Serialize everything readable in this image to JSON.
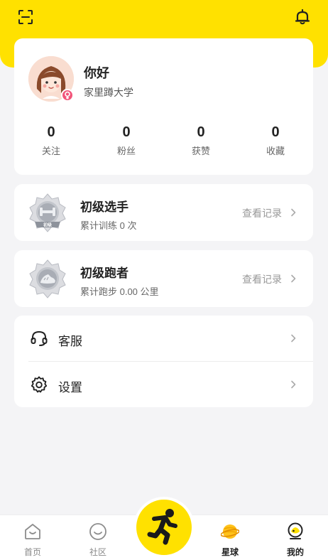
{
  "header": {
    "scan_icon": "scan-icon",
    "bell_icon": "bell-icon"
  },
  "profile": {
    "name": "你好",
    "school": "家里蹲大学",
    "gender": "female",
    "stats": [
      {
        "value": "0",
        "label": "关注"
      },
      {
        "value": "0",
        "label": "粉丝"
      },
      {
        "value": "0",
        "label": "获赞"
      },
      {
        "value": "0",
        "label": "收藏"
      }
    ]
  },
  "achievements": [
    {
      "title": "初级选手",
      "subtitle": "累计训练 0 次",
      "link": "查看记录",
      "badge_text": "初级"
    },
    {
      "title": "初级跑者",
      "subtitle": "累计跑步 0.00 公里",
      "link": "查看记录"
    }
  ],
  "menu": [
    {
      "label": "客服",
      "icon": "headset-icon"
    },
    {
      "label": "设置",
      "icon": "gear-icon"
    }
  ],
  "tabbar": {
    "tabs": [
      {
        "label": "首页",
        "icon": "home-icon",
        "active": false
      },
      {
        "label": "社区",
        "icon": "community-icon",
        "active": false
      },
      {
        "label": "星球",
        "icon": "planet-icon",
        "active": true
      },
      {
        "label": "我的",
        "icon": "me-icon",
        "active": true
      }
    ],
    "center_icon": "runner-icon"
  },
  "colors": {
    "brand_yellow": "#ffe100",
    "gender_badge": "#f2557a",
    "background": "#f4f4f6"
  }
}
